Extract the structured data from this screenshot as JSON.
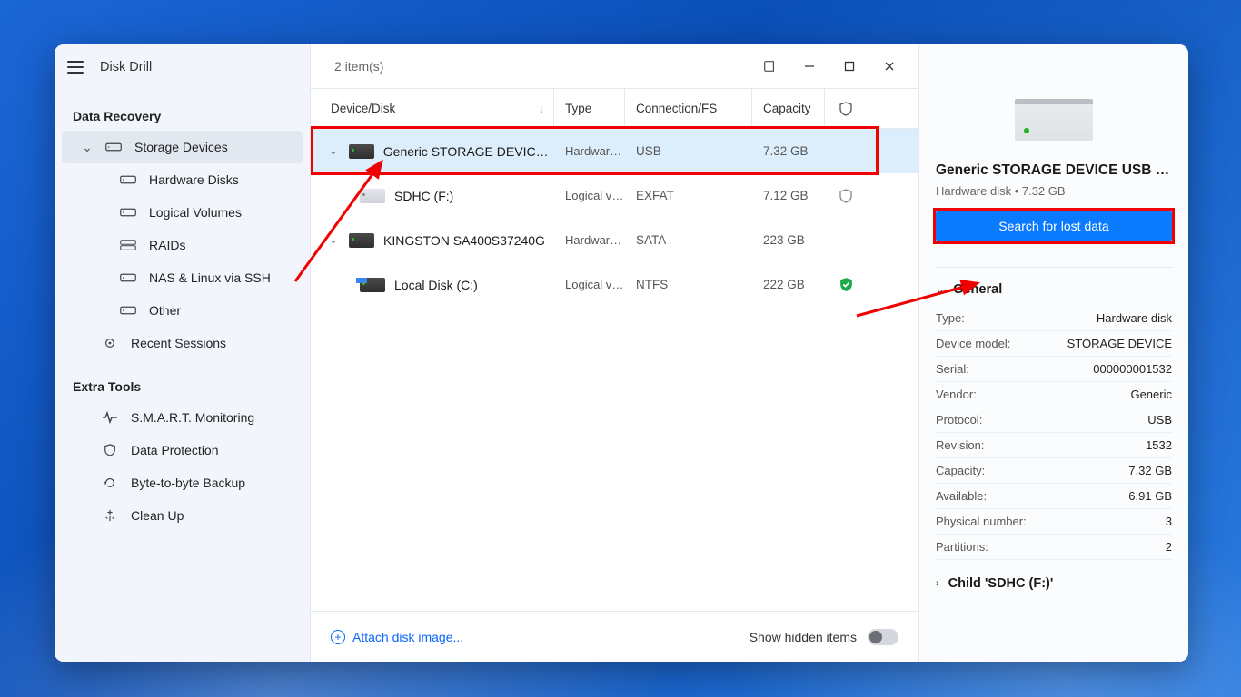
{
  "app": {
    "title": "Disk Drill"
  },
  "sidebar": {
    "data_recovery_header": "Data Recovery",
    "storage_devices": "Storage Devices",
    "hardware_disks": "Hardware Disks",
    "logical_volumes": "Logical Volumes",
    "raids": "RAIDs",
    "nas_linux": "NAS & Linux via SSH",
    "other": "Other",
    "recent_sessions": "Recent Sessions",
    "extra_tools_header": "Extra Tools",
    "smart": "S.M.A.R.T. Monitoring",
    "data_protection": "Data Protection",
    "byte_backup": "Byte-to-byte Backup",
    "clean_up": "Clean Up"
  },
  "main": {
    "item_count": "2 item(s)",
    "cols": {
      "device": "Device/Disk",
      "type": "Type",
      "connection": "Connection/FS",
      "capacity": "Capacity"
    },
    "rows": [
      {
        "name": "Generic STORAGE DEVICE…",
        "type": "Hardware…",
        "conn": "USB",
        "cap": "7.32 GB",
        "child": false,
        "expandable": true,
        "selected": true,
        "shield": "none"
      },
      {
        "name": "SDHC (F:)",
        "type": "Logical vol…",
        "conn": "EXFAT",
        "cap": "7.12 GB",
        "child": true,
        "expandable": false,
        "selected": false,
        "shield": "outline"
      },
      {
        "name": "KINGSTON SA400S37240G",
        "type": "Hardware…",
        "conn": "SATA",
        "cap": "223 GB",
        "child": false,
        "expandable": true,
        "selected": false,
        "shield": "none"
      },
      {
        "name": "Local Disk (C:)",
        "type": "Logical vol…",
        "conn": "NTFS",
        "cap": "222 GB",
        "child": true,
        "expandable": false,
        "selected": false,
        "shield": "green"
      }
    ],
    "footer": {
      "attach": "Attach disk image...",
      "show_hidden": "Show hidden items"
    }
  },
  "details": {
    "title": "Generic STORAGE DEVICE USB De…",
    "subtitle": "Hardware disk • 7.32 GB",
    "search_btn": "Search for lost data",
    "general_header": "General",
    "props": [
      {
        "k": "Type:",
        "v": "Hardware disk"
      },
      {
        "k": "Device model:",
        "v": "STORAGE DEVICE"
      },
      {
        "k": "Serial:",
        "v": "000000001532"
      },
      {
        "k": "Vendor:",
        "v": "Generic"
      },
      {
        "k": "Protocol:",
        "v": "USB"
      },
      {
        "k": "Revision:",
        "v": "1532"
      },
      {
        "k": "Capacity:",
        "v": "7.32 GB"
      },
      {
        "k": "Available:",
        "v": "6.91 GB"
      },
      {
        "k": "Physical number:",
        "v": "3"
      },
      {
        "k": "Partitions:",
        "v": "2"
      }
    ],
    "child_header": "Child 'SDHC (F:)'"
  }
}
